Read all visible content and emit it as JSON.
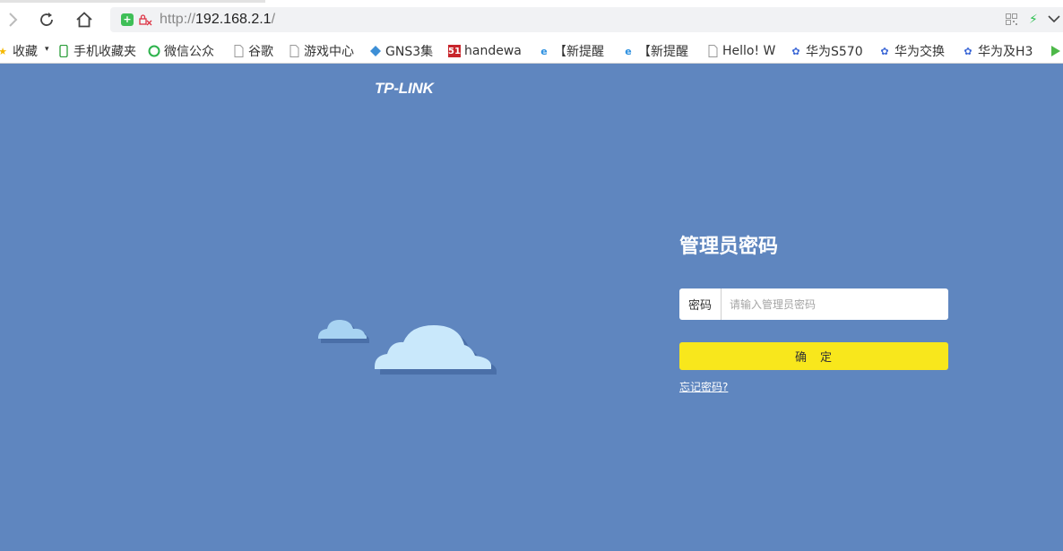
{
  "browser": {
    "url_prefix": "http://",
    "url_host": "192.168.2.1",
    "url_suffix": "/"
  },
  "bookmarks": [
    {
      "label": "收藏",
      "icon": "star-icon"
    },
    {
      "label": "手机收藏夹",
      "icon": "phone-icon"
    },
    {
      "label": "微信公众",
      "icon": "wechat-icon"
    },
    {
      "label": "谷歌",
      "icon": "page-icon"
    },
    {
      "label": "游戏中心",
      "icon": "page-icon"
    },
    {
      "label": "GNS3集",
      "icon": "gns3-icon"
    },
    {
      "label": "handewa",
      "icon": "site-51-icon"
    },
    {
      "label": "【新提醒",
      "icon": "ie-icon"
    },
    {
      "label": "【新提醒",
      "icon": "ie-icon"
    },
    {
      "label": "Hello! W",
      "icon": "page-icon"
    },
    {
      "label": "华为S570",
      "icon": "baidu-paw-icon"
    },
    {
      "label": "华为交换",
      "icon": "baidu-paw-icon"
    },
    {
      "label": "华为及H3",
      "icon": "baidu-paw-icon"
    }
  ],
  "page": {
    "logo": "TP-LINK",
    "title": "管理员密码",
    "password_label": "密码",
    "password_placeholder": "请输入管理员密码",
    "confirm_label": "确　定",
    "forgot_link": "忘记密码?"
  },
  "colors": {
    "background": "#5f86bf",
    "button": "#f8e71c",
    "cloud": "#c9e8fb",
    "cloud_shadow": "#4a6fa8"
  }
}
